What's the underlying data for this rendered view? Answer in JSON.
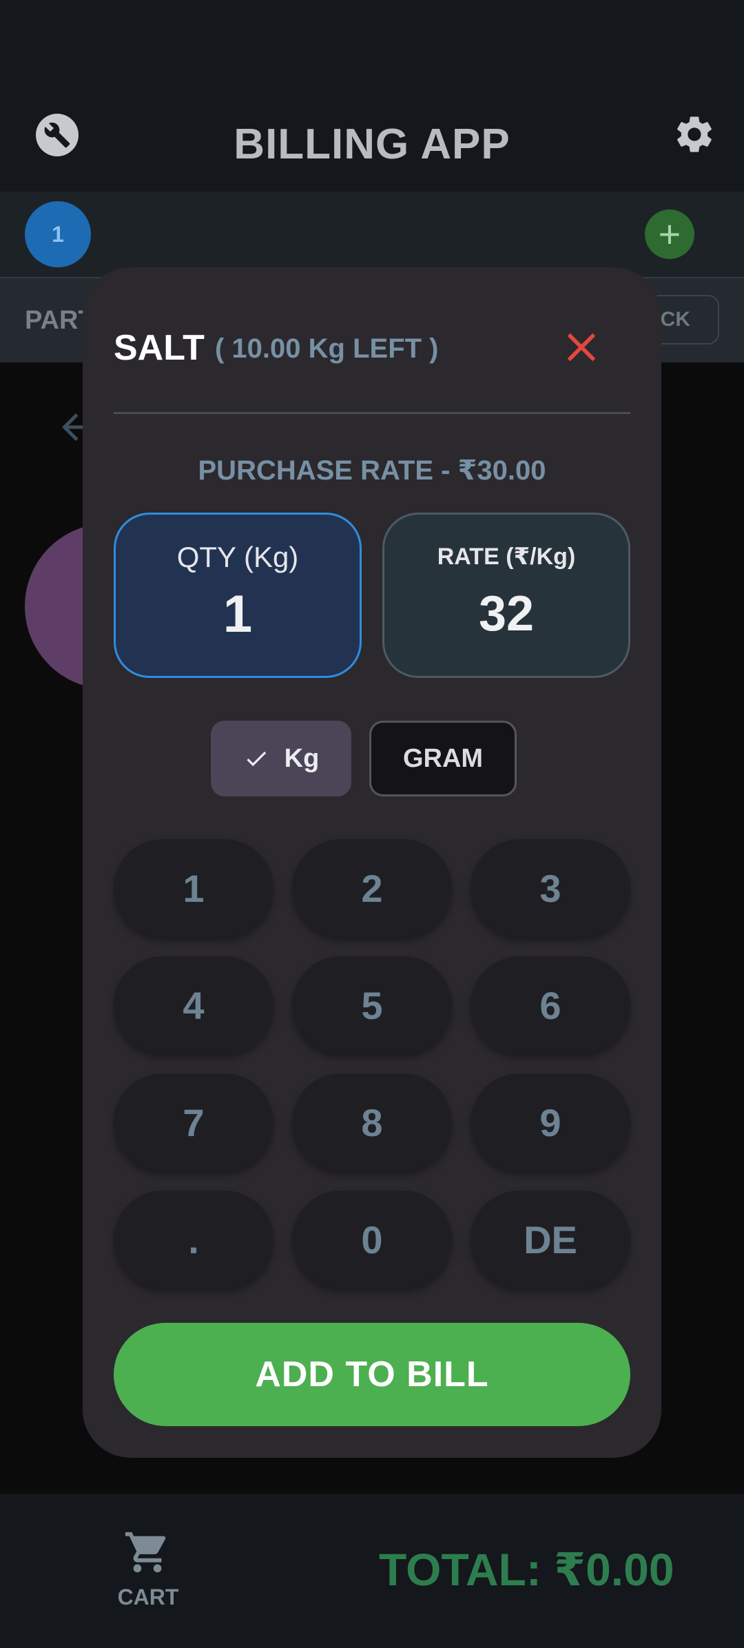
{
  "app": {
    "title": "BILLING APP",
    "tab_number": "1",
    "add_tab_symbol": "+",
    "party_label": "PART",
    "back_label": "ACK",
    "cart_label": "CART",
    "total": "TOTAL: ₹0.00"
  },
  "dialog": {
    "item_name": "SALT",
    "stock_left": "( 10.00 Kg LEFT )",
    "purchase_rate": "PURCHASE RATE - ₹30.00",
    "qty_label": "QTY (Kg)",
    "qty_value": "1",
    "rate_label": "RATE (₹/Kg)",
    "rate_value": "32",
    "units": {
      "selected": "Kg",
      "kg_label": "Kg",
      "gram_label": "GRAM"
    },
    "keypad": [
      "1",
      "2",
      "3",
      "4",
      "5",
      "6",
      "7",
      "8",
      "9",
      ".",
      "0",
      "DE"
    ],
    "add_button": "ADD TO BILL"
  },
  "colors": {
    "accent_green": "#4caf50",
    "qty_border_blue": "#2f8de0",
    "close_red": "#e5473c",
    "total_green": "#2e7d4f"
  },
  "icons": [
    "wrench-icon",
    "gear-icon",
    "plus-icon",
    "back-arrow-icon",
    "close-icon",
    "check-icon",
    "cart-icon"
  ]
}
